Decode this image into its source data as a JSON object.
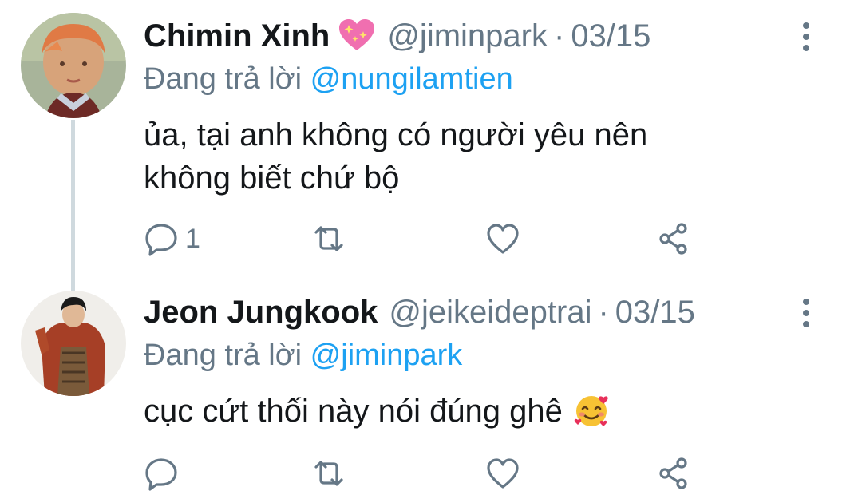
{
  "tweets": [
    {
      "name": "Chimin Xinh",
      "name_emoji": "sparkling-heart",
      "handle": "@jiminpark",
      "separator": "·",
      "date": "03/15",
      "reply_prefix": "Đang trả lời",
      "reply_to": "@nungilamtien",
      "text_line1": "ủa, tại anh không có người yêu nên",
      "text_line2": "không biết chứ bộ",
      "reply_count": "1"
    },
    {
      "name": "Jeon Jungkook",
      "handle": "@jeikeideptrai",
      "separator": "·",
      "date": "03/15",
      "reply_prefix": "Đang trả lời",
      "reply_to": "@jiminpark",
      "text": "cục cứt thối này nói đúng ghê",
      "text_emoji": "smiling-face-with-hearts",
      "reply_count": ""
    }
  ],
  "colors": {
    "text": "#14171a",
    "muted": "#657786",
    "accent": "#1da1f2",
    "thread_line": "#cfd9de"
  }
}
